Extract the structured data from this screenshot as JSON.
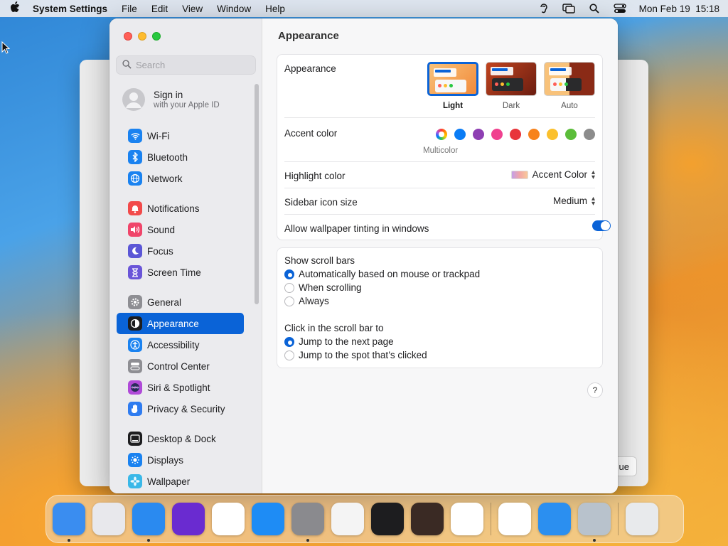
{
  "menubar": {
    "app_name": "System Settings",
    "menus": [
      "File",
      "Edit",
      "View",
      "Window",
      "Help"
    ],
    "clock": "Mon Feb 19  15:18"
  },
  "background_window": {
    "button_label": "ue"
  },
  "sidebar": {
    "search_placeholder": "Search",
    "account": {
      "title": "Sign in",
      "subtitle": "with your Apple ID"
    },
    "groups": [
      [
        {
          "label": "Wi-Fi",
          "icon": "wifi-icon",
          "color": "#1a82f0"
        },
        {
          "label": "Bluetooth",
          "icon": "bluetooth-icon",
          "color": "#1a82f0"
        },
        {
          "label": "Network",
          "icon": "globe-icon",
          "color": "#1a82f0"
        }
      ],
      [
        {
          "label": "Notifications",
          "icon": "bell-icon",
          "color": "#f24a4a"
        },
        {
          "label": "Sound",
          "icon": "speaker-icon",
          "color": "#f0456a"
        },
        {
          "label": "Focus",
          "icon": "moon-icon",
          "color": "#5b56d6"
        },
        {
          "label": "Screen Time",
          "icon": "hourglass-icon",
          "color": "#6a55d8"
        }
      ],
      [
        {
          "label": "General",
          "icon": "gear-icon",
          "color": "#8e8e93"
        },
        {
          "label": "Appearance",
          "icon": "appearance-icon",
          "color": "#1d1d1f",
          "active": true
        },
        {
          "label": "Accessibility",
          "icon": "accessibility-icon",
          "color": "#1a82f0"
        },
        {
          "label": "Control Center",
          "icon": "control-center-icon",
          "color": "#8e8e93"
        },
        {
          "label": "Siri & Spotlight",
          "icon": "siri-icon",
          "color": "#b04ad8"
        },
        {
          "label": "Privacy & Security",
          "icon": "hand-icon",
          "color": "#2f7cf0"
        }
      ],
      [
        {
          "label": "Desktop & Dock",
          "icon": "dock-icon",
          "color": "#1d1d1f"
        },
        {
          "label": "Displays",
          "icon": "sun-icon",
          "color": "#1a82f0"
        },
        {
          "label": "Wallpaper",
          "icon": "flower-icon",
          "color": "#3ab8e8"
        }
      ]
    ]
  },
  "content": {
    "title": "Appearance",
    "appearance": {
      "label": "Appearance",
      "options": [
        {
          "label": "Light",
          "selected": true
        },
        {
          "label": "Dark",
          "selected": false
        },
        {
          "label": "Auto",
          "selected": false
        }
      ]
    },
    "accent": {
      "label": "Accent color",
      "colors": [
        "#0a7cf5",
        "#8e3fb3",
        "#f0418f",
        "#e8353a",
        "#f7821b",
        "#fbc02d",
        "#5bbd3a",
        "#8c8c8c"
      ],
      "multicolor_label": "Multicolor"
    },
    "highlight": {
      "label": "Highlight color",
      "value": "Accent Color"
    },
    "sidebar_icon_size": {
      "label": "Sidebar icon size",
      "value": "Medium"
    },
    "tinting": {
      "label": "Allow wallpaper tinting in windows",
      "enabled": true
    },
    "scrollbars": {
      "label": "Show scroll bars",
      "options": [
        {
          "label": "Automatically based on mouse or trackpad",
          "selected": true
        },
        {
          "label": "When scrolling",
          "selected": false
        },
        {
          "label": "Always",
          "selected": false
        }
      ]
    },
    "click_scroll": {
      "label": "Click in the scroll bar to",
      "options": [
        {
          "label": "Jump to the next page",
          "selected": true
        },
        {
          "label": "Jump to the spot that’s clicked",
          "selected": false
        }
      ]
    },
    "help_label": "?"
  },
  "dock": {
    "apps": [
      {
        "name": "finder-icon",
        "color": "#3a8df0",
        "running": true
      },
      {
        "name": "launchpad-icon",
        "color": "#e8e8ec",
        "running": false
      },
      {
        "name": "safari-icon",
        "color": "#2a8af0",
        "running": true
      },
      {
        "name": "firefox-icon",
        "color": "#6a2bd0",
        "running": false
      },
      {
        "name": "chrome-icon",
        "color": "#ffffff",
        "running": false
      },
      {
        "name": "app-store-icon",
        "color": "#1e8cf5",
        "running": false
      },
      {
        "name": "system-settings-icon",
        "color": "#8a8a8e",
        "running": true
      },
      {
        "name": "textedit-icon",
        "color": "#f4f4f4",
        "running": false
      },
      {
        "name": "terminal-icon",
        "color": "#1d1d1f",
        "running": false
      },
      {
        "name": "garageband-icon",
        "color": "#3a2a24",
        "running": false
      },
      {
        "name": "vscode-icon",
        "color": "#ffffff",
        "running": false
      }
    ],
    "apps2": [
      {
        "name": "visual-studio-icon",
        "color": "#ffffff",
        "running": false
      },
      {
        "name": "weather-icon",
        "color": "#2b8ff0",
        "running": false
      },
      {
        "name": "preview-finder-icon",
        "color": "#b8c2cc",
        "running": true
      }
    ],
    "trash": {
      "name": "trash-icon",
      "color": "#e8eaec"
    }
  }
}
